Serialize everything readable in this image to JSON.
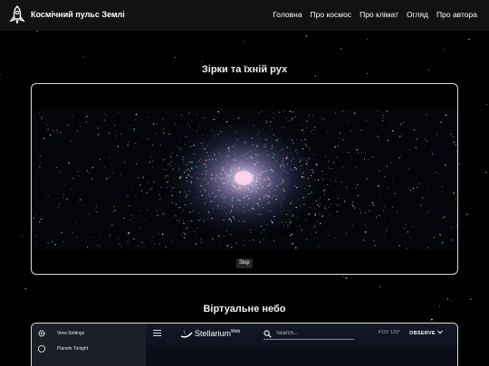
{
  "header": {
    "brand": "Космічний пульс Землі",
    "logo_icon": "rocket-icon",
    "nav": [
      "Головна",
      "Про космос",
      "Про клімат",
      "Огляд",
      "Про автора"
    ]
  },
  "sections": {
    "stars_title": "Зірки та їхній рух",
    "sky_title": "Віртуальне небо"
  },
  "video": {
    "skip_label": "Skip"
  },
  "stellarium": {
    "sidebar": [
      {
        "label": "View Settings",
        "icon": "gear-icon"
      },
      {
        "label": "Planets Tonight",
        "icon": "circle-icon"
      }
    ],
    "app_name": "Stellarium",
    "app_suffix": "Web",
    "search_placeholder": "Search...",
    "fov": "FOV 120°",
    "observe": "OBSERVE"
  },
  "colors": {
    "background": "#000000",
    "navbar": "#121212",
    "frame_border": "#dddddd"
  }
}
